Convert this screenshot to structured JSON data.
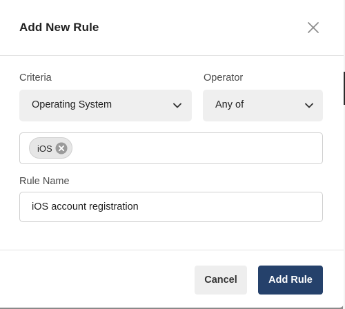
{
  "dialog": {
    "title": "Add New Rule",
    "close_icon": "close-icon"
  },
  "criteria": {
    "label": "Criteria",
    "selected": "Operating System",
    "icon": "chevron-down-icon"
  },
  "operator": {
    "label": "Operator",
    "selected": "Any of",
    "icon": "chevron-down-icon"
  },
  "values": {
    "tags": [
      {
        "label": "iOS",
        "remove_icon": "remove-circle-icon"
      }
    ]
  },
  "rule_name": {
    "label": "Rule Name",
    "value": "iOS account registration"
  },
  "footer": {
    "cancel_label": "Cancel",
    "submit_label": "Add Rule"
  },
  "colors": {
    "primary": "#25416b",
    "secondary_button": "#eeeeee",
    "select_background": "#efefef"
  }
}
